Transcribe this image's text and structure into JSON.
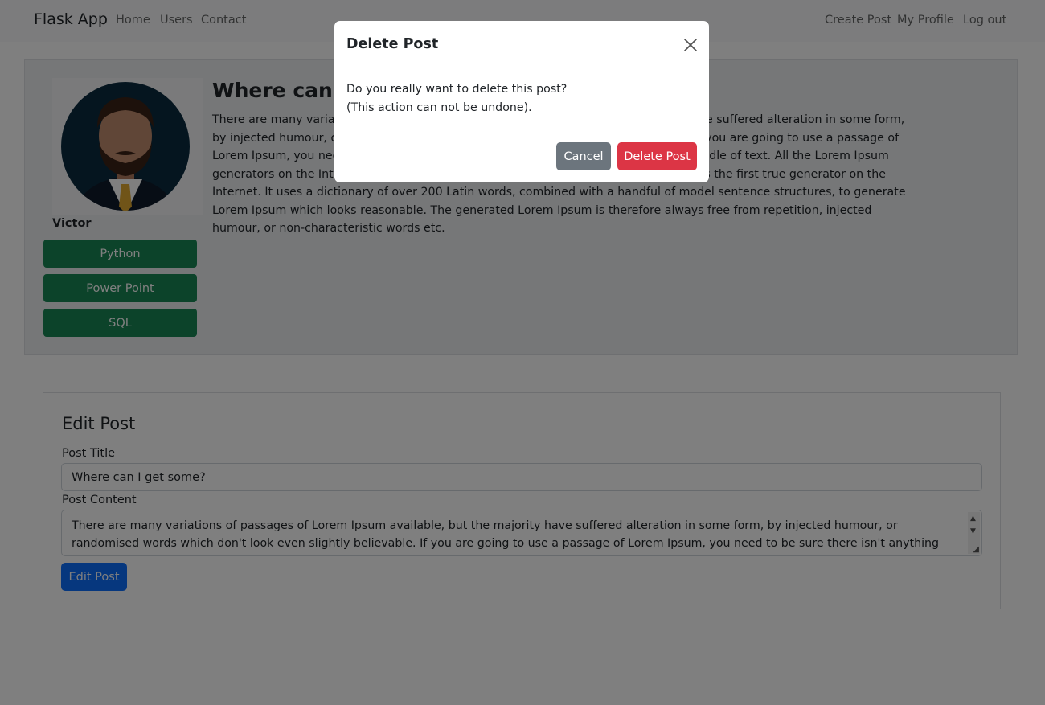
{
  "navbar": {
    "brand": "Flask App",
    "left_links": [
      "Home",
      "Users",
      "Contact"
    ],
    "right_links": [
      "Create Post",
      "My Profile",
      "Log out"
    ]
  },
  "post": {
    "title": "Where can I get some?",
    "author": "Victor",
    "skills": [
      "Python",
      "Power Point",
      "SQL"
    ],
    "content": "There are many variations of passages of Lorem Ipsum available, but the majority have suffered alteration in some form, by injected humour, or randomised words which don't look even slightly believable. If you are going to use a passage of Lorem Ipsum, you need to be sure there isn't anything embarrassing hidden in the middle of text. All the Lorem Ipsum generators on the Internet tend to repeat predefined chunks as necessary, making this the first true generator on the Internet. It uses a dictionary of over 200 Latin words, combined with a handful of model sentence structures, to generate Lorem Ipsum which looks reasonable. The generated Lorem Ipsum is therefore always free from repetition, injected humour, or non-characteristic words etc."
  },
  "edit_form": {
    "heading": "Edit Post",
    "title_label": "Post Title",
    "title_value": "Where can I get some?",
    "content_label": "Post Content",
    "content_value": "There are many variations of passages of Lorem Ipsum available, but the majority have suffered alteration in some form, by injected humour, or randomised words which don't look even slightly believable. If you are going to use a passage of Lorem Ipsum, you need to be sure there isn't anything embarrassing hidden in the middle of text. All the Lorem Ipsum generators on the Internet tend to repeat predefined chunks as necessary, making this the first true generator on the Internet.",
    "submit_label": "Edit Post"
  },
  "modal": {
    "title": "Delete Post",
    "message_line1": "Do you really want to delete this post?",
    "message_line2": "(This action can not be undone).",
    "cancel_label": "Cancel",
    "delete_label": "Delete Post"
  },
  "icons": {
    "close": "close-icon",
    "avatar": "avatar-icon",
    "scroll_up": "scroll-up-icon",
    "scroll_down": "scroll-down-icon",
    "resize": "resize-grip-icon"
  },
  "colors": {
    "skill_badge": "#198754",
    "primary": "#0d6efd",
    "danger": "#dc3545",
    "secondary": "#6c757d"
  }
}
